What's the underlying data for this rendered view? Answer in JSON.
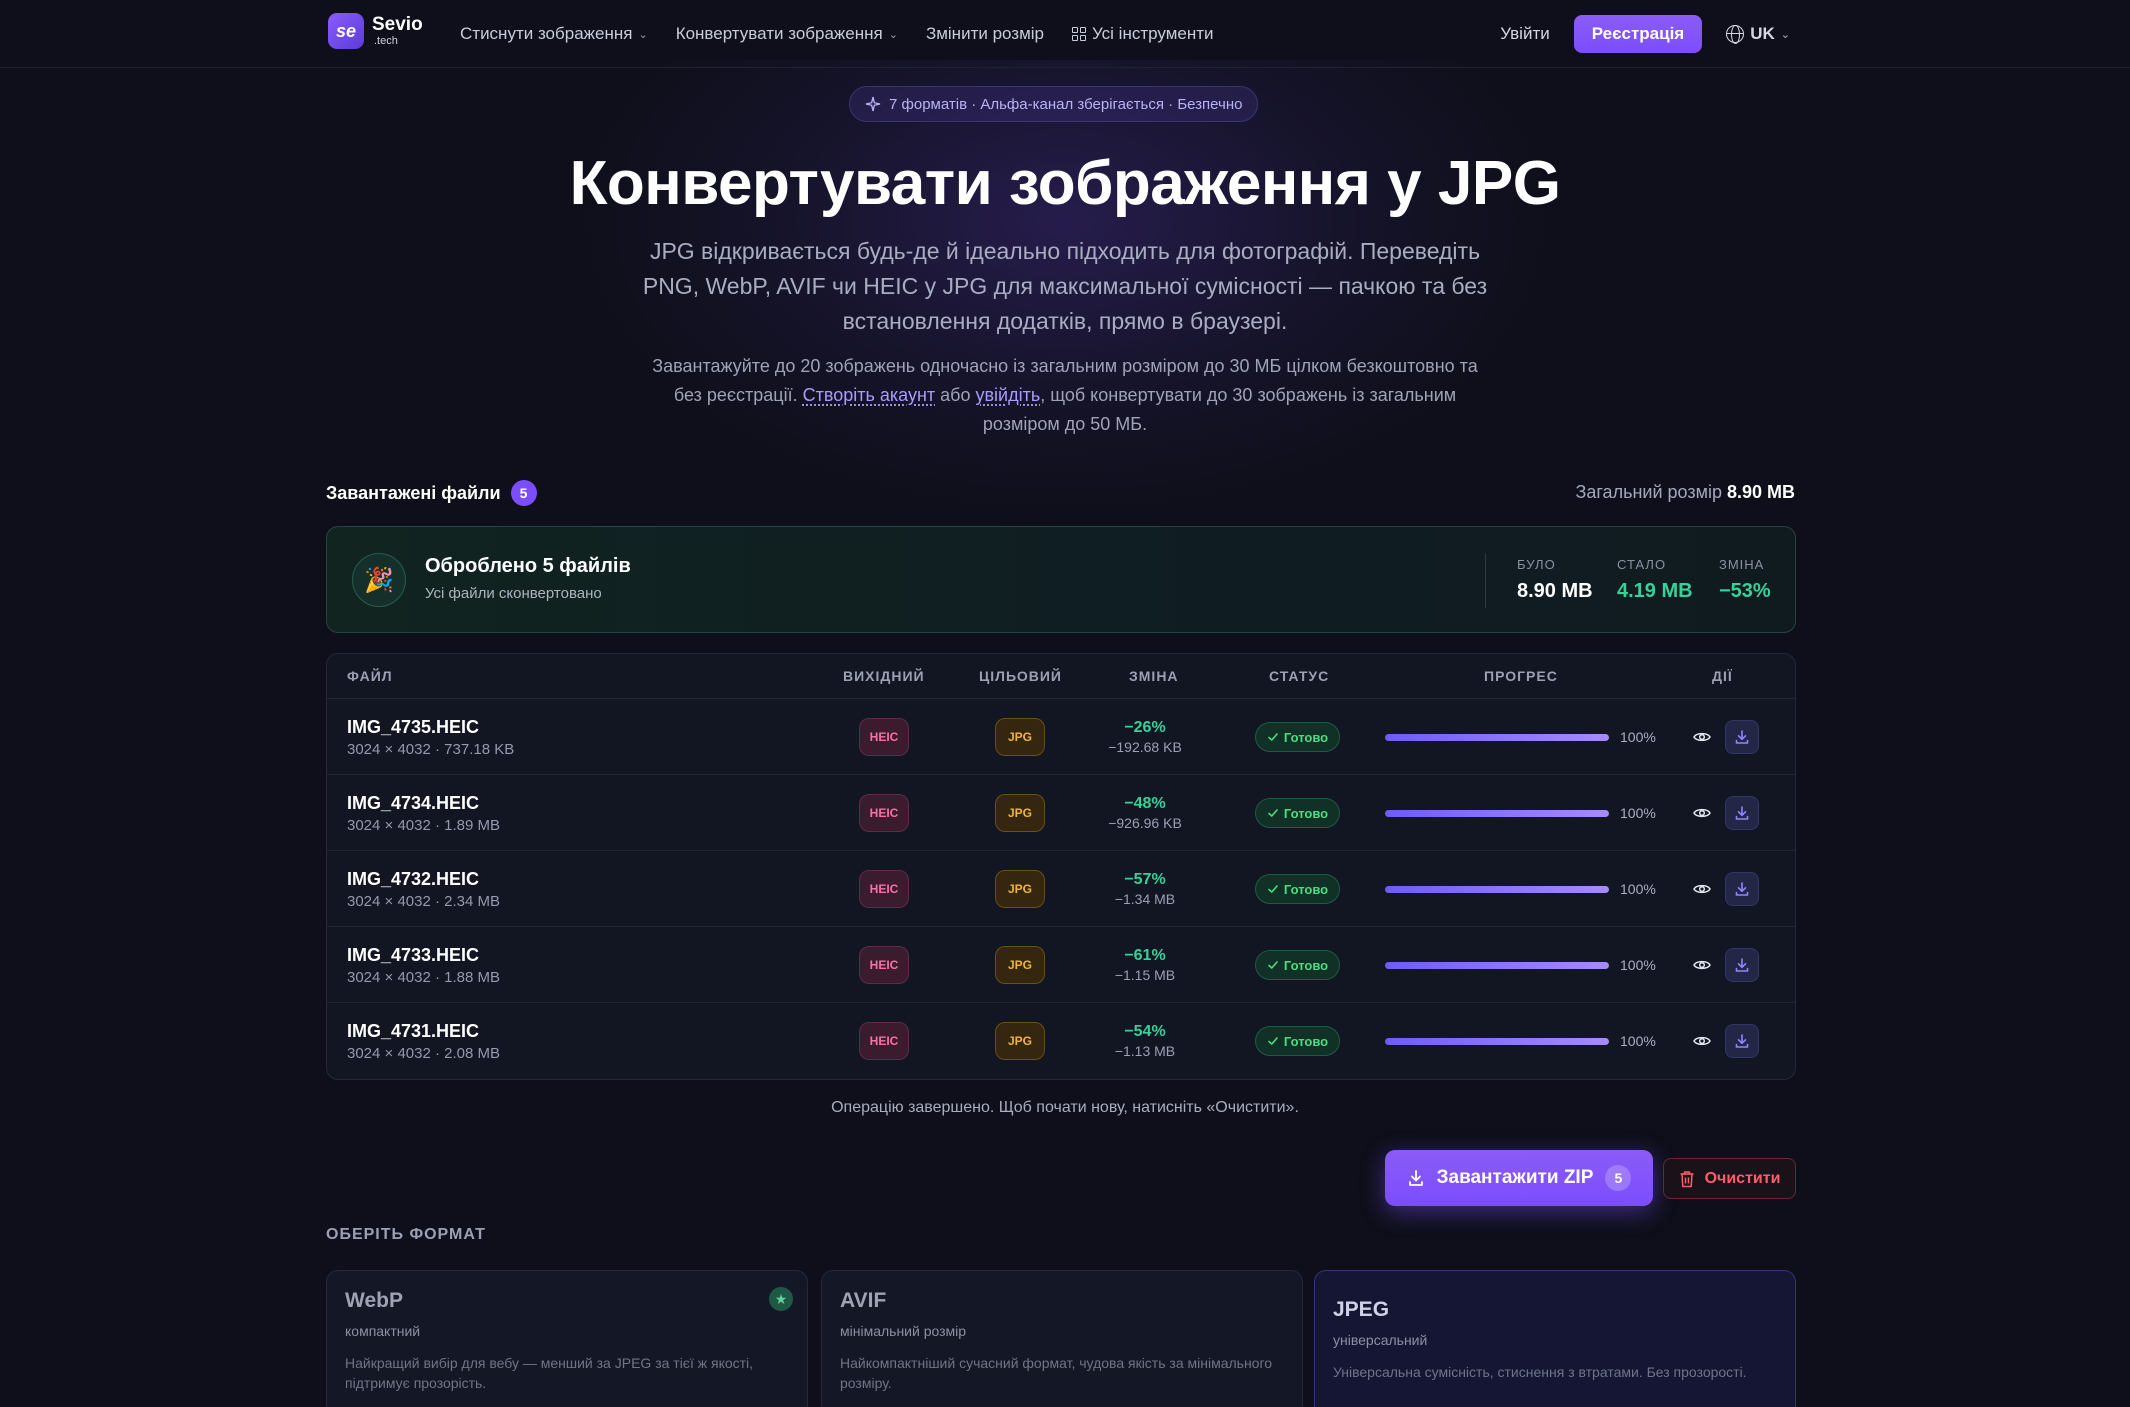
{
  "nav": {
    "logo_main": "Sevio",
    "logo_sub": ".tech",
    "links": [
      {
        "label": "Стиснути зображення"
      },
      {
        "label": "Конвертувати зображення"
      },
      {
        "label": "Змінити розмір"
      },
      {
        "label": "Усі інструменти"
      }
    ],
    "login": "Увійти",
    "register": "Реєстрація",
    "lang": "UK"
  },
  "hero": {
    "pill": "7 форматів · Альфа-канал зберігається · Безпечно",
    "title": "Конвертувати зображення у JPG",
    "subtitle": "JPG відкривається будь-де й ідеально підходить для фотографій. Переведіть PNG, WebP, AVIF чи HEIC у JPG для максимальної сумісності — пачкою та без встановлення додатків, прямо в браузері.",
    "note_a": "Завантажуйте до 20 зображень одночасно із загальним розміром до 30 МБ цілком безкоштовно та без реєстрації. ",
    "note_link1": "Створіть акаунт",
    "note_b": " або ",
    "note_link2": "увійдіть",
    "note_c": ", щоб конвертувати до 30 зображень із загальним розміром до 50 МБ."
  },
  "uploads": {
    "label": "Завантажені файли",
    "count": "5",
    "total_label": "Загальний розмір",
    "total_value": "8.90 MB"
  },
  "summary": {
    "title": "Оброблено 5 файлів",
    "subtitle": "Усі файли сконвертовано",
    "was_label": "БУЛО",
    "was_value": "8.90 MB",
    "now_label": "СТАЛО",
    "now_value": "4.19 MB",
    "change_label": "ЗМІНА",
    "change_value": "−53%",
    "colors": {
      "now": "#34d399",
      "change": "#34d399"
    }
  },
  "table": {
    "headers": [
      "ФАЙЛ",
      "ВИХІДНИЙ",
      "ЦІЛЬОВИЙ",
      "ЗМІНА",
      "СТАТУС",
      "ПРОГРЕС",
      "ДІЇ"
    ],
    "rows": [
      {
        "name": "IMG_4735.HEIC",
        "meta": "3024 × 4032 · 737.18 KB",
        "src": "HEIC",
        "dst": "JPG",
        "pct": "−26%",
        "delta": "−192.68 KB",
        "status": "Готово",
        "progress": 100,
        "progress_label": "100%"
      },
      {
        "name": "IMG_4734.HEIC",
        "meta": "3024 × 4032 · 1.89 MB",
        "src": "HEIC",
        "dst": "JPG",
        "pct": "−48%",
        "delta": "−926.96 KB",
        "status": "Готово",
        "progress": 100,
        "progress_label": "100%"
      },
      {
        "name": "IMG_4732.HEIC",
        "meta": "3024 × 4032 · 2.34 MB",
        "src": "HEIC",
        "dst": "JPG",
        "pct": "−57%",
        "delta": "−1.34 MB",
        "status": "Готово",
        "progress": 100,
        "progress_label": "100%"
      },
      {
        "name": "IMG_4733.HEIC",
        "meta": "3024 × 4032 · 1.88 MB",
        "src": "HEIC",
        "dst": "JPG",
        "pct": "−61%",
        "delta": "−1.15 MB",
        "status": "Готово",
        "progress": 100,
        "progress_label": "100%"
      },
      {
        "name": "IMG_4731.HEIC",
        "meta": "3024 × 4032 · 2.08 MB",
        "src": "HEIC",
        "dst": "JPG",
        "pct": "−54%",
        "delta": "−1.13 MB",
        "status": "Готово",
        "progress": 100,
        "progress_label": "100%"
      }
    ]
  },
  "done_message": "Операцію завершено. Щоб почати нову, натисніть «Очистити».",
  "actions": {
    "zip_label": "Завантажити ZIP",
    "zip_count": "5",
    "clear_label": "Очистити"
  },
  "formats": {
    "title": "ОБЕРІТЬ ФОРМАТ",
    "cards": [
      {
        "name": "WebP",
        "tag": "компактний",
        "desc": "Найкращий вибір для вебу — менший за JPEG за тієї ж якості, підтримує прозорість.",
        "recommended": true
      },
      {
        "name": "AVIF",
        "tag": "мінімальний розмір",
        "desc": "Найкомпактніший сучасний формат, чудова якість за мінімального розміру."
      },
      {
        "name": "JPEG",
        "tag": "універсальний",
        "desc": "Універсальна сумісність, стиснення з втратами. Без прозорості.",
        "selected": true
      }
    ]
  },
  "colors": {
    "accent": "#7c4dff",
    "success": "#34d399",
    "danger": "#ff5c6c",
    "background": "#0e0f1a"
  }
}
